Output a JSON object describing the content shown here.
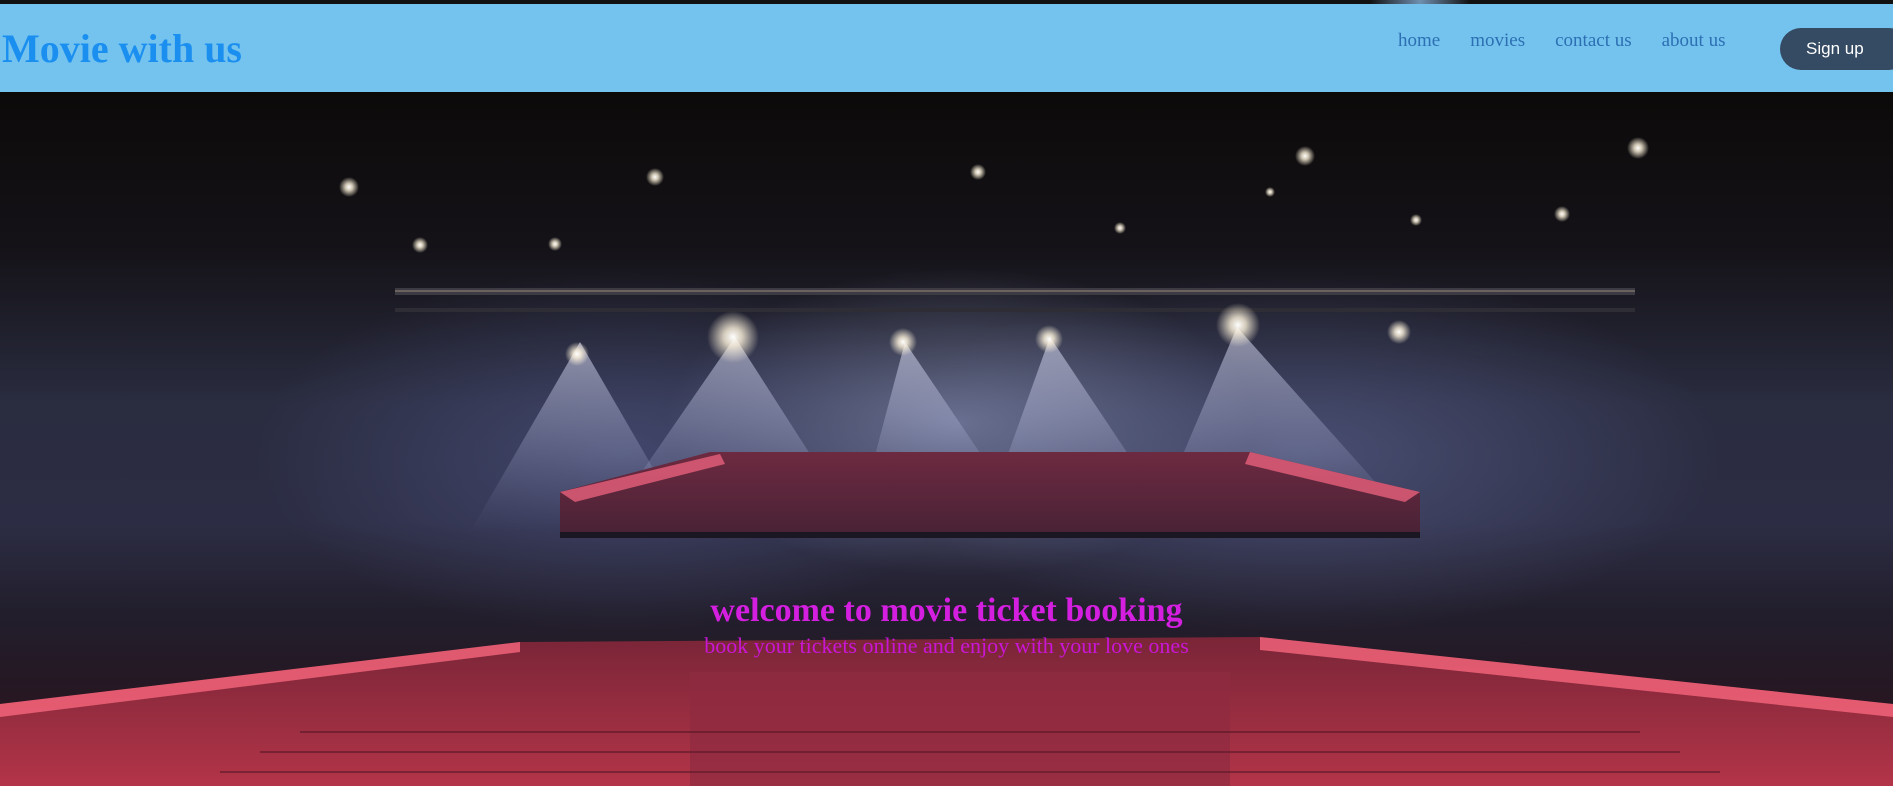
{
  "header": {
    "brand": "Movie with us",
    "nav": [
      {
        "label": "home"
      },
      {
        "label": "movies"
      },
      {
        "label": "contact us"
      },
      {
        "label": "about us"
      }
    ],
    "signup_label": "Sign up"
  },
  "hero": {
    "title": "welcome to movie ticket booking",
    "subtitle": "book your tickets online and enjoy with your love ones",
    "image": "theater-stage-with-spotlights-and-red-seats"
  },
  "colors": {
    "navbar": "#74c3ee",
    "brand": "#1a8ff0",
    "nav_link": "#2c6fb3",
    "signup_bg": "#354a63",
    "hero_text": "#d41fe0"
  }
}
